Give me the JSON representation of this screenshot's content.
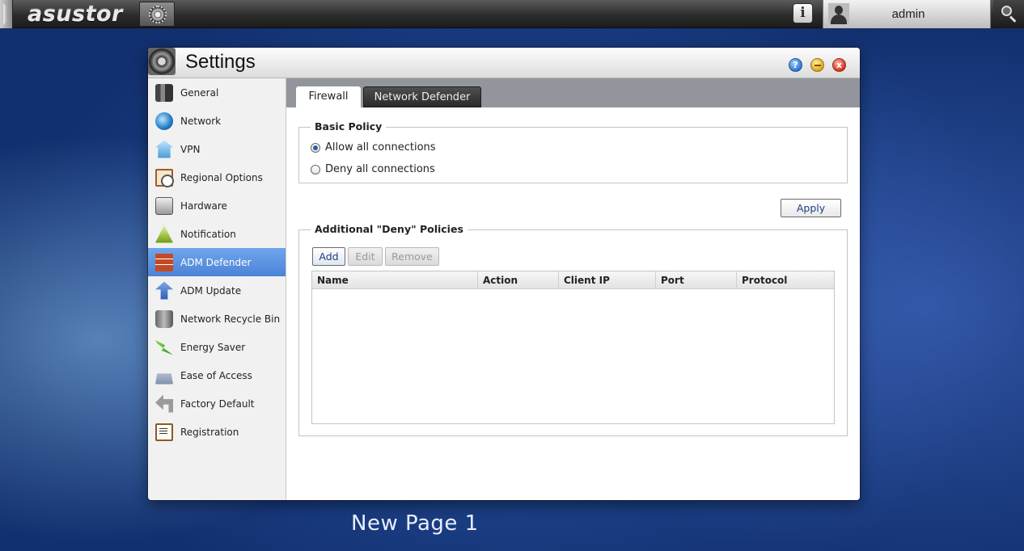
{
  "taskbar": {
    "logo": "asustor",
    "user": "admin",
    "info_glyph": "i",
    "icons": [
      "app-launcher-icon",
      "info-icon",
      "user-icon",
      "search-icon"
    ]
  },
  "window": {
    "title": "Settings",
    "buttons": {
      "help": "?",
      "minimize": "",
      "close": "x"
    }
  },
  "sidebar": {
    "items": [
      {
        "label": "General",
        "icon": "general-icon"
      },
      {
        "label": "Network",
        "icon": "network-icon"
      },
      {
        "label": "VPN",
        "icon": "vpn-icon"
      },
      {
        "label": "Regional Options",
        "icon": "regional-options-icon"
      },
      {
        "label": "Hardware",
        "icon": "hardware-icon"
      },
      {
        "label": "Notification",
        "icon": "notification-icon"
      },
      {
        "label": "ADM Defender",
        "icon": "adm-defender-icon",
        "active": true
      },
      {
        "label": "ADM Update",
        "icon": "adm-update-icon"
      },
      {
        "label": "Network Recycle Bin",
        "icon": "recycle-bin-icon"
      },
      {
        "label": "Energy Saver",
        "icon": "energy-saver-icon"
      },
      {
        "label": "Ease of Access",
        "icon": "ease-of-access-icon"
      },
      {
        "label": "Factory Default",
        "icon": "factory-default-icon"
      },
      {
        "label": "Registration",
        "icon": "registration-icon"
      }
    ]
  },
  "tabs": [
    {
      "label": "Firewall",
      "active": true
    },
    {
      "label": "Network Defender",
      "active": false
    }
  ],
  "basic_policy": {
    "title": "Basic Policy",
    "options": [
      {
        "label": "Allow all connections",
        "checked": true
      },
      {
        "label": "Deny all connections",
        "checked": false
      }
    ]
  },
  "apply_label": "Apply",
  "deny_policies": {
    "title": "Additional \"Deny\" Policies",
    "buttons": {
      "add": "Add",
      "edit": "Edit",
      "remove": "Remove"
    },
    "columns": [
      "Name",
      "Action",
      "Client IP",
      "Port",
      "Protocol"
    ],
    "rows": []
  },
  "page_caption": "New Page 1",
  "colors": {
    "active_item": "#4b83d7",
    "tab_bar": "#92969c",
    "desktop": "#2b56a8"
  }
}
